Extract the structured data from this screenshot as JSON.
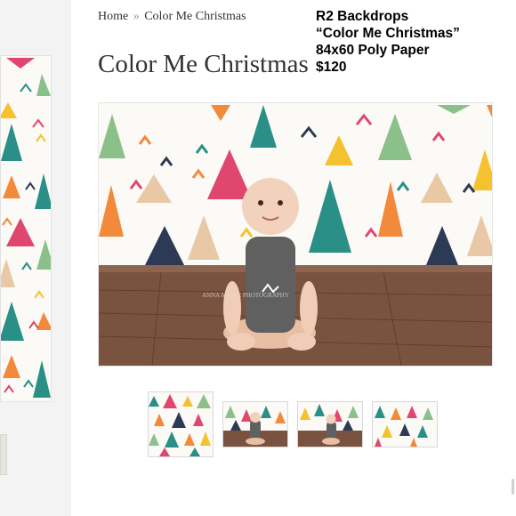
{
  "breadcrumb": {
    "home": "Home",
    "separator": "»",
    "current": "Color Me Christmas"
  },
  "product": {
    "title": "Color Me Christmas"
  },
  "overlay": {
    "line1": "R2 Backdrops",
    "line2": "“Color Me Christmas”",
    "line3": "84x60 Poly Paper",
    "line4": "$120"
  },
  "image": {
    "watermark": "ANNA MARIE PHOTOGRAPHY"
  },
  "thumbnails": [
    {
      "name": "backdrop-only"
    },
    {
      "name": "baby-center"
    },
    {
      "name": "baby-right"
    },
    {
      "name": "backdrop-wide"
    }
  ],
  "colors": {
    "cream": "#fbfaf6",
    "green": "#8cc08a",
    "teal": "#2a8f86",
    "pink": "#e0476f",
    "orange": "#f3893a",
    "yellow": "#f4c22e",
    "navy": "#2d3a55",
    "beige": "#e9c8a6",
    "wood": "#7a5340"
  }
}
